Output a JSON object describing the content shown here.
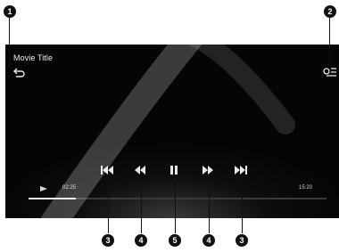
{
  "player": {
    "title": "Movie Title",
    "elapsed": "02:25",
    "total": "15:20",
    "progress_fraction": 0.16
  },
  "icons": {
    "back": "back-icon",
    "settings": "settings-icon",
    "previous": "skip-previous-icon",
    "rewind": "rewind-icon",
    "pause": "pause-icon",
    "fast_forward": "fast-forward-icon",
    "next": "skip-next-icon",
    "play_indicator": "play-icon"
  },
  "callouts": {
    "c1": "1",
    "c2": "2",
    "c3a": "3",
    "c4a": "4",
    "c5": "5",
    "c4b": "4",
    "c3b": "3"
  },
  "colors": {
    "screen": "#050505",
    "text": "#f0f0f0",
    "callout": "#111111"
  }
}
